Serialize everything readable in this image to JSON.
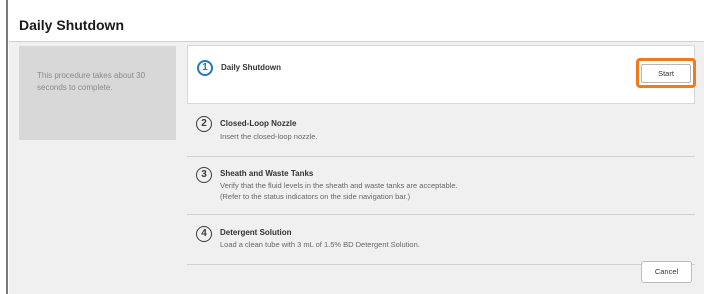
{
  "dialog": {
    "title": "Daily Shutdown",
    "info": "This procedure takes about 30 seconds to complete."
  },
  "steps": [
    {
      "number": "1",
      "title": "Daily Shutdown",
      "description": "",
      "button": "Start"
    },
    {
      "number": "2",
      "title": "Closed-Loop Nozzle",
      "description": "Insert the closed-loop nozzle."
    },
    {
      "number": "3",
      "title": "Sheath and Waste Tanks",
      "description": "Verify that the fluid levels in the sheath and waste tanks are acceptable.",
      "description2": "(Refer to the status indicators on the side navigation bar.)"
    },
    {
      "number": "4",
      "title": "Detergent Solution",
      "description": "Load a clean tube with 3 mL of 1.5% BD Detergent Solution."
    }
  ],
  "footer": {
    "cancel_label": "Cancel"
  },
  "colors": {
    "active_step": "#1e7bc6",
    "highlight": "#f07b1a"
  }
}
